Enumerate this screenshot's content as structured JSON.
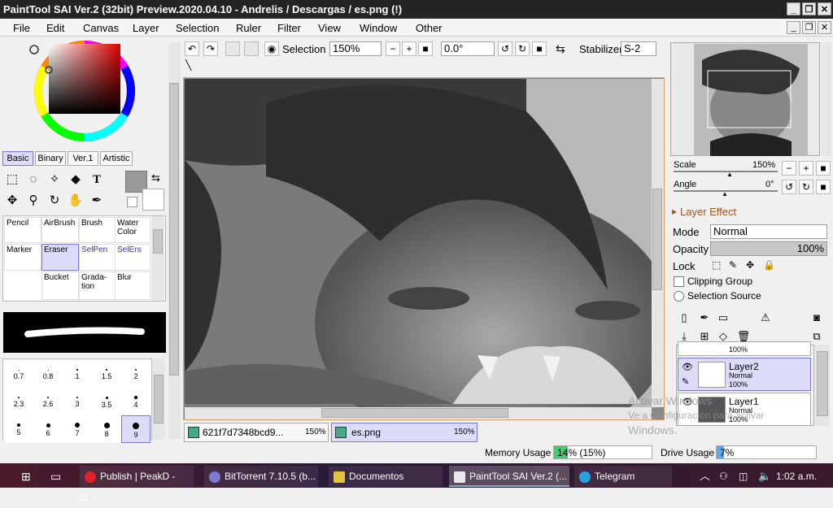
{
  "window": {
    "title": "PaintTool SAI Ver.2 (32bit) Preview.2020.04.10 - Andrelis / Descargas / es.png (!)"
  },
  "menu": [
    "File",
    "Edit",
    "Canvas",
    "Layer",
    "Selection",
    "Ruler",
    "Filter",
    "View",
    "Window",
    "Other"
  ],
  "toolbar": {
    "selection_label": "Selection",
    "zoom": "150%",
    "angle": "0.0°",
    "stabilizer_label": "Stabilizer",
    "stabilizer": "S-2"
  },
  "tool_tabs": [
    "Basic",
    "Binary",
    "Ver.1",
    "Artistic"
  ],
  "brushes": [
    [
      "Pencil",
      "AirBrush",
      "Brush",
      "Water Color"
    ],
    [
      "Marker",
      "Eraser",
      "SelPen",
      "SelErs"
    ],
    [
      "",
      "Bucket",
      "Grada-tion",
      "Blur"
    ]
  ],
  "sizes": [
    [
      "0.7",
      "0.8",
      "1",
      "1.5",
      "2"
    ],
    [
      "2.3",
      "2.6",
      "3",
      "3.5",
      "4"
    ],
    [
      "5",
      "6",
      "7",
      "8",
      "9"
    ]
  ],
  "doc_tabs": [
    {
      "name": "621f7d7348bcd9...",
      "zoom": "150%"
    },
    {
      "name": "es.png",
      "zoom": "150%"
    }
  ],
  "navigator": {
    "scale_label": "Scale",
    "scale": "150%",
    "angle_label": "Angle",
    "angle": "0°"
  },
  "layer_panel": {
    "effect_label": "Layer Effect",
    "mode_label": "Mode",
    "mode": "Normal",
    "opacity_label": "Opacity",
    "opacity": "100%",
    "lock_label": "Lock",
    "clipping": "Clipping Group",
    "selection_source": "Selection Source"
  },
  "layers": [
    {
      "name": "",
      "mode": "",
      "opacity": "100%"
    },
    {
      "name": "Layer2",
      "mode": "Normal",
      "opacity": "100%"
    },
    {
      "name": "Layer1",
      "mode": "Normal",
      "opacity": "100%"
    }
  ],
  "status": {
    "memory_label": "Memory Usage",
    "memory": "14% (15%)",
    "memory_fraction": 0.14,
    "drive_label": "Drive Usage",
    "drive": "7%",
    "drive_fraction": 0.07
  },
  "watermark": [
    "Activar Windows",
    "Ve a Configuración para activar",
    "Windows."
  ],
  "taskbar": {
    "items": [
      "Publish | PeakD - O...",
      "BitTorrent 7.10.5  (b...",
      "Documentos",
      "PaintTool SAI Ver.2 (...",
      "Telegram"
    ],
    "time": "1:02 a.m."
  },
  "colors": {
    "accent": "#5050d0",
    "titlebar": "#242424",
    "taskbar": "#1f1f28"
  }
}
